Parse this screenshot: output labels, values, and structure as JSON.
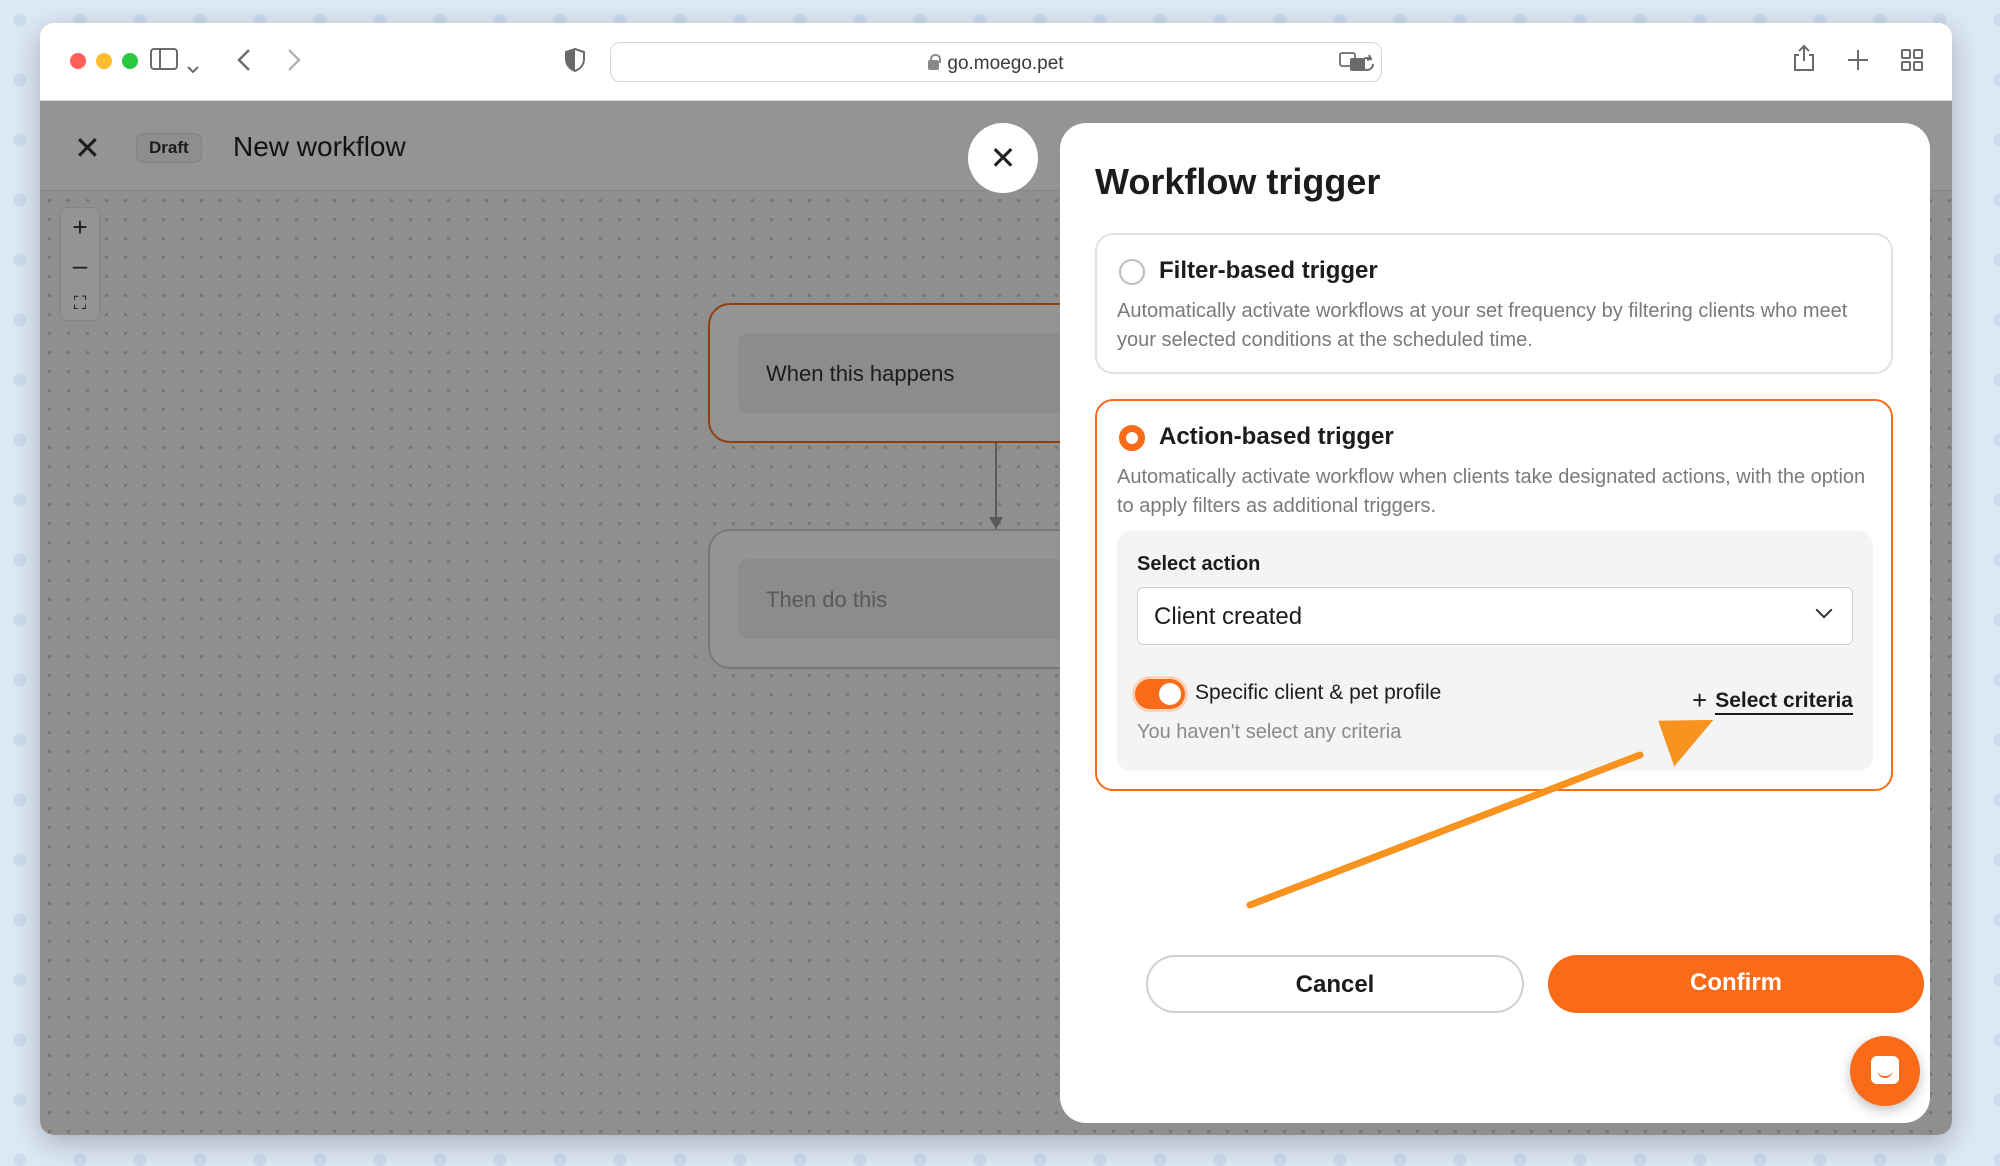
{
  "browser": {
    "url": "go.moego.pet",
    "address_icons": [
      "lock-icon",
      "translate-icon",
      "reload-icon"
    ],
    "toolbar_icons": [
      "sidebar-icon",
      "chevron-down-icon",
      "back-icon",
      "forward-icon",
      "shield-icon",
      "share-icon",
      "plus-icon",
      "tabs-grid-icon"
    ]
  },
  "app": {
    "draft_badge": "Draft",
    "title": "New workflow",
    "zoom_in": "+",
    "zoom_out": "–",
    "fit_view": "⛶",
    "nodes": {
      "when": "When this happens",
      "then": "Then do this"
    }
  },
  "drawer": {
    "title": "Workflow trigger",
    "filter_trigger": {
      "title": "Filter-based trigger",
      "description": "Automatically activate workflows at your set frequency by filtering clients who meet your selected conditions at the scheduled time.",
      "selected": false
    },
    "action_trigger": {
      "title": "Action-based trigger",
      "description": "Automatically activate workflow when clients take designated actions, with the option to apply filters as additional triggers.",
      "selected": true,
      "select_action_label": "Select action",
      "select_action_value": "Client created",
      "toggle_label": "Specific client & pet profile",
      "toggle_on": true,
      "criteria_hint": "You haven't select any criteria",
      "select_criteria_label": "Select criteria"
    },
    "cancel_label": "Cancel",
    "confirm_label": "Confirm"
  },
  "colors": {
    "accent": "#f96b18",
    "annotation_arrow": "#f7931e"
  }
}
